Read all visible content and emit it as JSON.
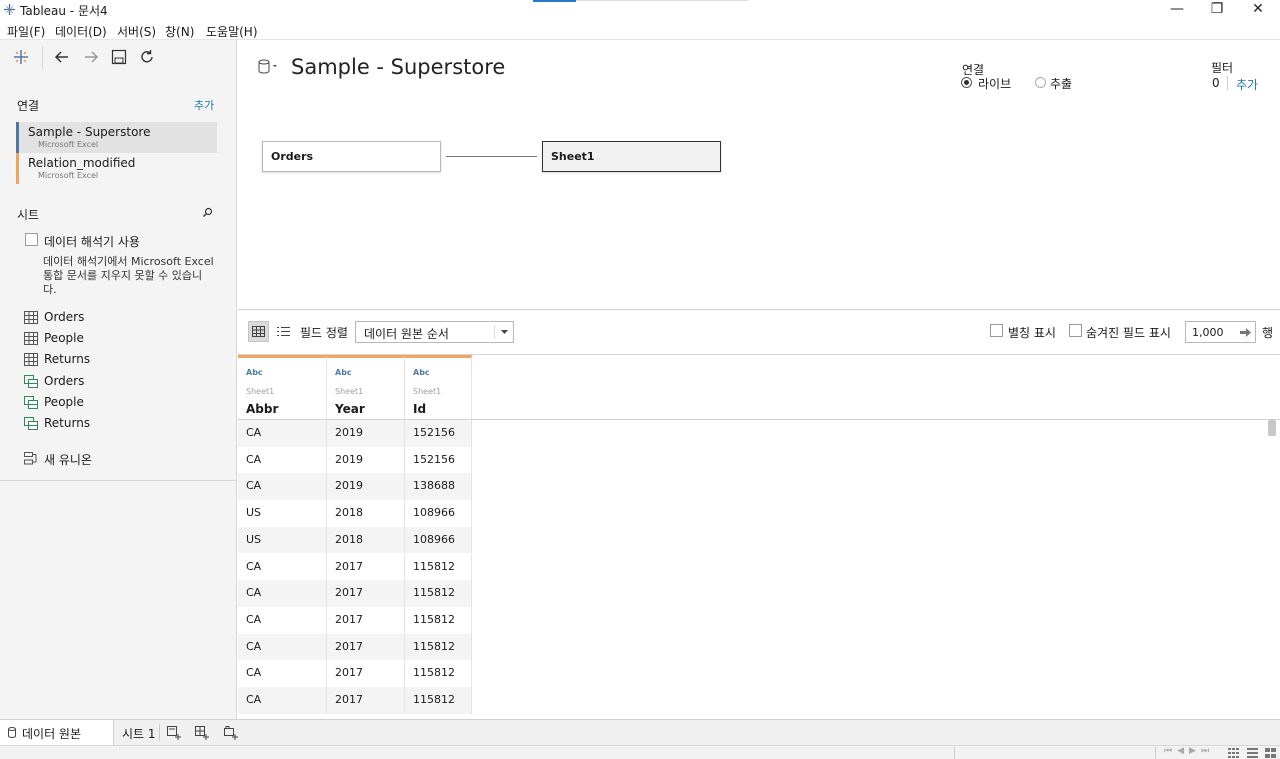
{
  "window": {
    "title": "Tableau - 문서4",
    "controls": {
      "minimize": "—",
      "restore": "❐",
      "close": "✕"
    }
  },
  "menu": [
    "파일(F)",
    "데이터(D)",
    "서버(S)",
    "창(N)",
    "도움말(H)"
  ],
  "left": {
    "connections_title": "연결",
    "add_label": "추가",
    "connections": [
      {
        "name": "Sample - Superstore",
        "type": "Microsoft Excel",
        "color": "#4e79a7",
        "selected": true
      },
      {
        "name": "Relation_modified",
        "type": "Microsoft Excel",
        "color": "#f28e2b",
        "selected": false
      }
    ],
    "sheets_title": "시트",
    "interpreter_label": "데이터 해석기 사용",
    "interpreter_note": "데이터 해석기에서 Microsoft Excel 통합 문서를 지우지 못할 수 있습니다.",
    "sheets": [
      {
        "name": "Orders",
        "icon": "table-icon"
      },
      {
        "name": "People",
        "icon": "table-icon"
      },
      {
        "name": "Returns",
        "icon": "table-icon"
      },
      {
        "name": "Orders",
        "icon": "named-range-icon"
      },
      {
        "name": "People",
        "icon": "named-range-icon"
      },
      {
        "name": "Returns",
        "icon": "named-range-icon"
      }
    ],
    "new_union": "새 유니온"
  },
  "canvas": {
    "datasource_name": "Sample - Superstore",
    "connection_label": "연결",
    "live_label": "라이브",
    "extract_label": "추출",
    "filter_label": "필터",
    "filter_count": "0",
    "filter_add": "추가",
    "tables": [
      "Orders",
      "Sheet1"
    ]
  },
  "gridbar": {
    "sort_label": "필드 정렬",
    "sort_value": "데이터 원본 순서",
    "alias_label": "별칭 표시",
    "hidden_label": "숨겨진 필드 표시",
    "rows_value": "1,000",
    "rows_suffix": "행"
  },
  "grid": {
    "columns": [
      {
        "type": "Abc",
        "source": "Sheet1",
        "name": "Abbr"
      },
      {
        "type": "Abc",
        "source": "Sheet1",
        "name": "Year"
      },
      {
        "type": "Abc",
        "source": "Sheet1",
        "name": "Id"
      }
    ],
    "rows": [
      [
        "CA",
        "2019",
        "152156"
      ],
      [
        "CA",
        "2019",
        "152156"
      ],
      [
        "CA",
        "2019",
        "138688"
      ],
      [
        "US",
        "2018",
        "108966"
      ],
      [
        "US",
        "2018",
        "108966"
      ],
      [
        "CA",
        "2017",
        "115812"
      ],
      [
        "CA",
        "2017",
        "115812"
      ],
      [
        "CA",
        "2017",
        "115812"
      ],
      [
        "CA",
        "2017",
        "115812"
      ],
      [
        "CA",
        "2017",
        "115812"
      ],
      [
        "CA",
        "2017",
        "115812"
      ]
    ]
  },
  "bottom_tabs": {
    "datasource": "데이터 원본",
    "sheet": "시트 1"
  }
}
